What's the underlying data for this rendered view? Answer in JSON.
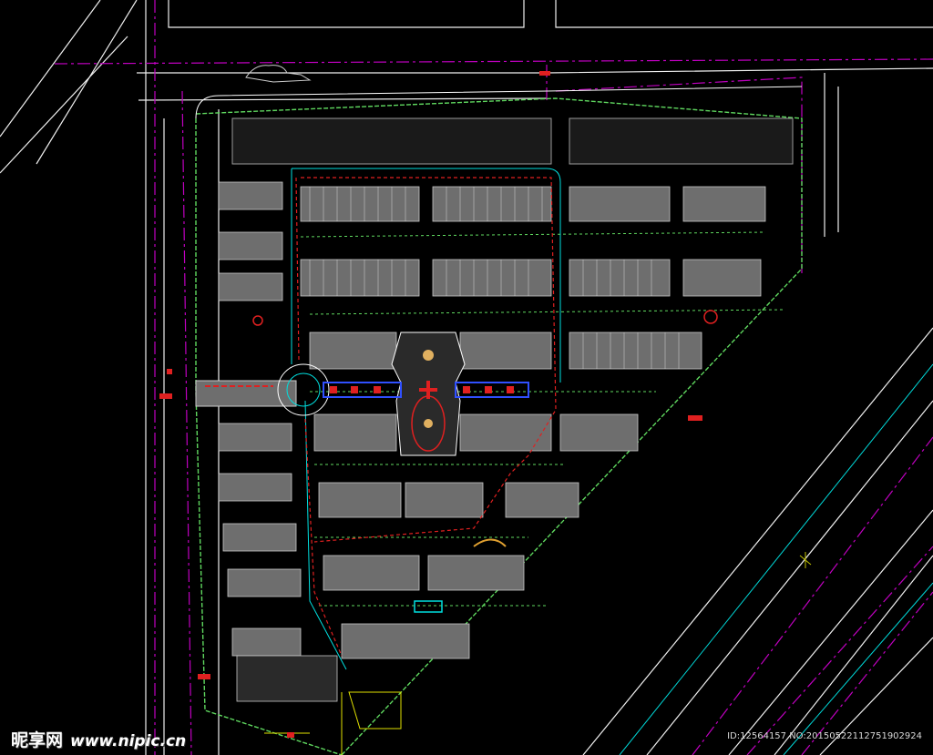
{
  "drawing": {
    "colors": {
      "background": "#000000",
      "road_white": "#f0f0f0",
      "road_magenta": "#c000c0",
      "boundary_green": "#5fd85f",
      "cyan": "#00e0e0",
      "block_gray": "#8a8a8a",
      "red": "#e02020",
      "blue": "#3050ff",
      "yellow": "#e0e000",
      "white": "#ffffff"
    },
    "elements": [
      "site-boundary",
      "perimeter-roads",
      "building-blocks",
      "central-plaza",
      "main-axis-road",
      "landscape-strip"
    ]
  },
  "watermark": {
    "brand": "昵享网",
    "url": "www.nipic.cn",
    "id_text": "ID:12564157 NO:20150522112751902924"
  }
}
